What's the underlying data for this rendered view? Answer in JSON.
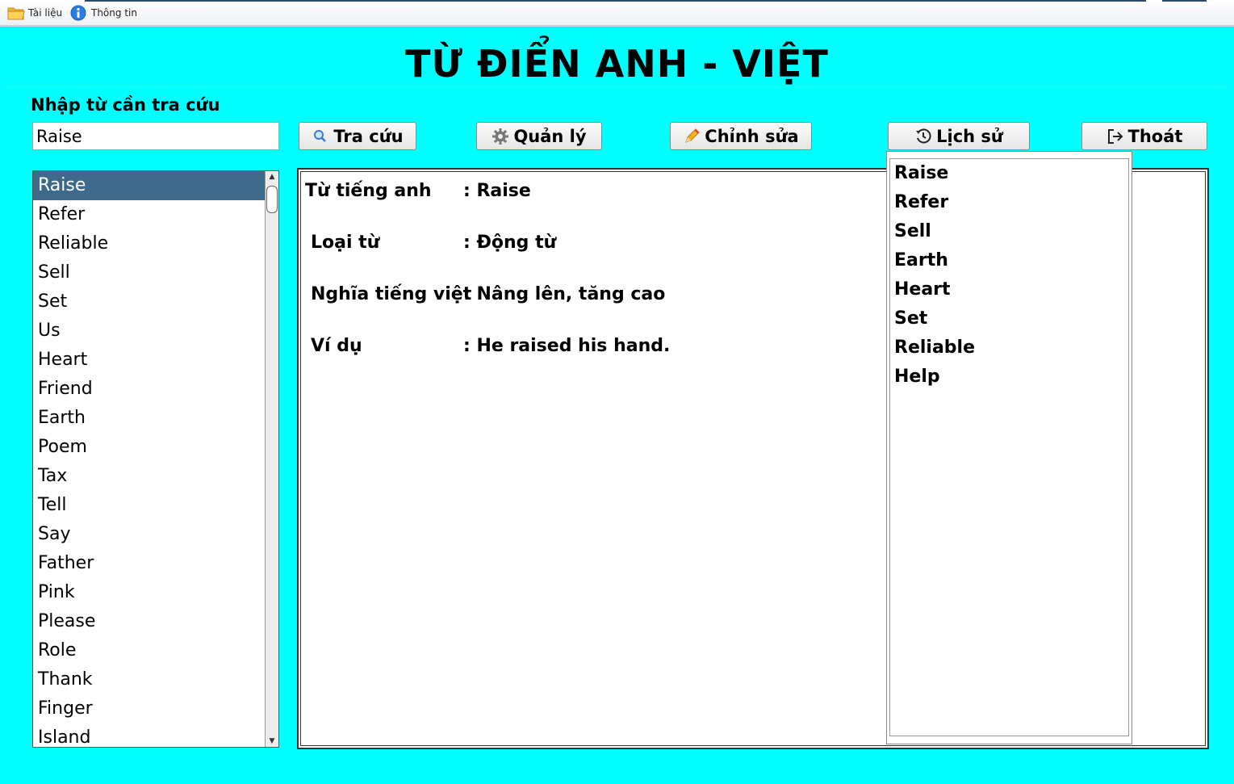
{
  "menubar": {
    "items": [
      {
        "label": "Tài liệu",
        "icon": "folder-icon"
      },
      {
        "label": "Thông tin",
        "icon": "info-icon"
      }
    ]
  },
  "header": {
    "title": "TỪ ĐIỂN ANH - VIỆT"
  },
  "search": {
    "label": "Nhập từ cần tra cứu",
    "value": "Raise"
  },
  "buttons": {
    "lookup": "Tra cứu",
    "manage": "Quản lý",
    "edit": "Chỉnh sửa",
    "history": "Lịch sử",
    "exit": "Thoát"
  },
  "word_list": {
    "selected": "Raise",
    "items": [
      "Raise",
      "Refer",
      "Reliable",
      "Sell",
      "Set",
      "Us",
      "Heart",
      "Friend",
      "Earth",
      "Poem",
      "Tax",
      "Tell",
      "Say",
      "Father",
      "Pink",
      "Please",
      "Role",
      "Thank",
      "Finger",
      "Island"
    ]
  },
  "detail": {
    "english_label": "Từ tiếng anh",
    "english_value": ": Raise",
    "type_label": "Loại từ",
    "type_value": ": Động từ",
    "meaning_label": "Nghĩa tiếng việt",
    "meaning_value": ": Nâng lên, tăng cao",
    "example_label": "Ví dụ",
    "example_value": ": He raised his hand."
  },
  "history": {
    "items": [
      "Raise",
      "Refer",
      "Sell",
      "Earth",
      "Heart",
      "Set",
      "Reliable",
      "Help"
    ]
  },
  "colors": {
    "background": "#00ffff",
    "selected_row": "#3d6a8b"
  }
}
